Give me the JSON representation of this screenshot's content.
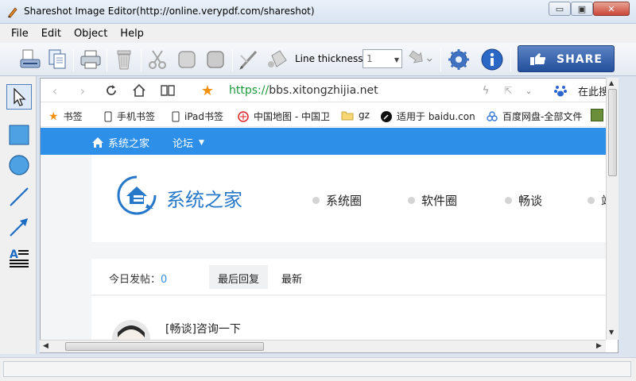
{
  "window": {
    "title": "Shareshot Image Editor(http://online.verypdf.com/shareshot)",
    "min_glyph": "▭",
    "max_glyph": "▣",
    "close_glyph": "✕"
  },
  "menu": [
    "File",
    "Edit",
    "Object",
    "Help"
  ],
  "toolbar": {
    "line_thickness_label": "Line thickness",
    "line_thickness_value": "1",
    "share_label": "SHARE",
    "accent_color": "#2a56a2",
    "tools": [
      "scanner-icon",
      "copy-pages-icon",
      "printer-icon",
      "trash-icon",
      "cut-icon",
      "bring-front-icon",
      "send-back-icon",
      "pen-icon",
      "bucket-fill-icon",
      "arrow-style-icon",
      "settings-icon",
      "info-icon"
    ]
  },
  "palette": [
    "select-pointer-icon",
    "rectangle-icon",
    "ellipse-icon",
    "line-icon",
    "arrow-icon",
    "text-icon"
  ],
  "browser": {
    "url_scheme": "https://",
    "url_host": "bbs.xitongzhijia.net",
    "search_placeholder": "在此搜",
    "bookmarks": [
      {
        "label": "书签",
        "icon": "star-icon"
      },
      {
        "label": "手机书签",
        "icon": "phone-icon"
      },
      {
        "label": "iPad书签",
        "icon": "tablet-icon"
      },
      {
        "label": "中国地图 - 中国卫",
        "icon": "map-icon"
      },
      {
        "label": "gz",
        "icon": "folder-icon"
      },
      {
        "label": "适用于 baidu.con",
        "icon": "tool-icon"
      },
      {
        "label": "百度网盘-全部文件",
        "icon": "cloud-icon"
      }
    ]
  },
  "site": {
    "home_label": "系统之家",
    "forum_label": "论坛",
    "logo_text": "系统之家",
    "nav": [
      "系统圈",
      "软件圈",
      "畅谈",
      "站"
    ],
    "today_label": "今日发帖：",
    "today_count": "0",
    "tabs": [
      "最后回复",
      "最新"
    ],
    "post_title": "[畅谈]咨询一下",
    "header_color": "#2e8fe9"
  }
}
